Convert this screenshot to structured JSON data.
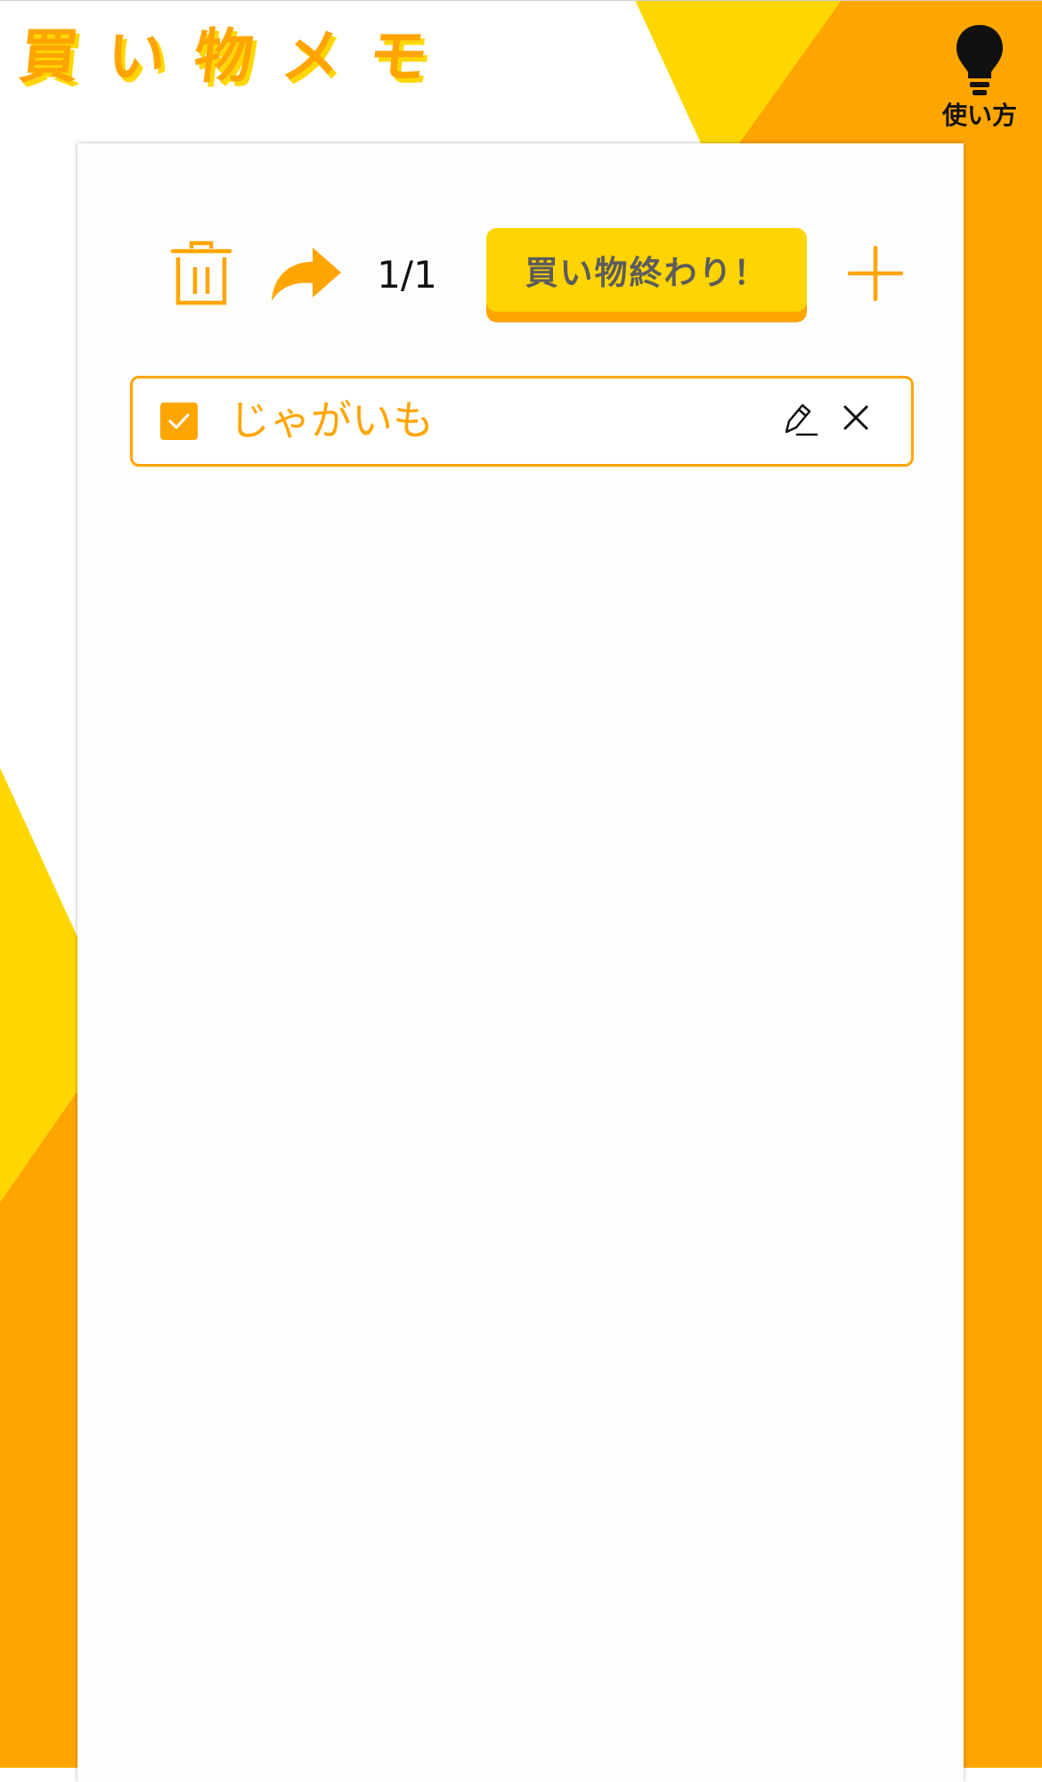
{
  "app": {
    "title": "買い物メモ"
  },
  "help": {
    "label": "使い方",
    "icon": "lightbulb-icon"
  },
  "toolbar": {
    "trash_icon": "trash-icon",
    "share_icon": "share-arrow-icon",
    "page_count": "1/1",
    "finish_label": "買い物終わり！",
    "add_icon": "plus-icon"
  },
  "items": [
    {
      "label": "じゃがいも",
      "checked": true,
      "edit_icon": "pencil-icon",
      "delete_icon": "close-icon"
    }
  ],
  "colors": {
    "accent_orange": "#ffa500",
    "accent_yellow": "#ffd700",
    "button_text": "#5c5c5c"
  }
}
